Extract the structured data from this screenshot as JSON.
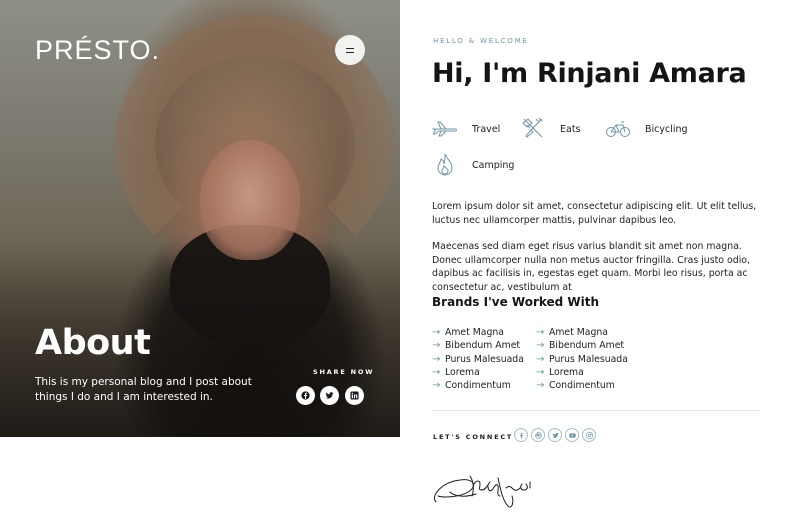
{
  "header": {
    "logo": "PRÉSTO.",
    "menu_icon": "hamburger-menu-icon"
  },
  "hero": {
    "title": "About",
    "description": "This is my personal blog and I post about things I do and I am interested in.",
    "share_label": "SHARE NOW",
    "share_icons": [
      "facebook-icon",
      "twitter-icon",
      "linkedin-icon"
    ]
  },
  "intro": {
    "greeting": "HELLO & WELCOME",
    "name": "Hi, I'm Rinjani Amara"
  },
  "interests": [
    {
      "icon": "airplane-icon",
      "label": "Travel"
    },
    {
      "icon": "fork-knife-icon",
      "label": "Eats"
    },
    {
      "icon": "bicycle-icon",
      "label": "Bicycling"
    },
    {
      "icon": "flame-icon",
      "label": "Camping"
    }
  ],
  "paragraphs": [
    "Lorem ipsum dolor sit amet, consectetur adipiscing elit. Ut elit tellus, luctus nec ullamcorper mattis, pulvinar dapibus leo.",
    "Maecenas sed diam eget risus varius blandit sit amet non magna. Donec ullamcorper nulla non metus auctor fringilla. Cras justo odio, dapibus ac facilisis in, egestas eget quam. Morbi leo risus, porta ac consectetur ac, vestibulum at"
  ],
  "brands": {
    "title": "Brands I've Worked With",
    "column1": [
      "Amet Magna",
      "Bibendum Amet",
      "Purus Malesuada",
      "Lorema",
      "Condimentum"
    ],
    "column2": [
      "Amet Magna",
      "Bibendum Amet",
      "Purus Malesuada",
      "Lorema",
      "Condimentum"
    ]
  },
  "connect": {
    "label": "LET'S CONNECT",
    "icons": [
      "facebook-icon",
      "dribbble-icon",
      "twitter-icon",
      "youtube-icon",
      "instagram-icon"
    ]
  },
  "colors": {
    "accent": "#6e95a5",
    "text": "#151515"
  }
}
